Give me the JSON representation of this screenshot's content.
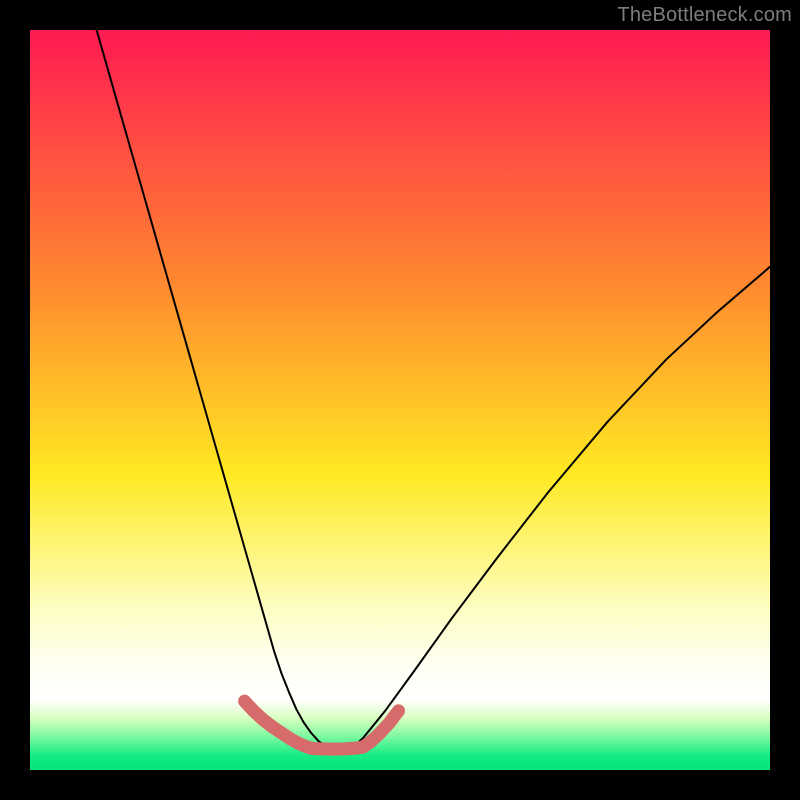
{
  "watermark": "TheBottleneck.com",
  "chart_data": {
    "type": "line",
    "title": "",
    "xlabel": "",
    "ylabel": "",
    "xlim": [
      0,
      100
    ],
    "ylim": [
      0,
      100
    ],
    "grid": false,
    "legend": false,
    "background_gradient": {
      "stops": [
        {
          "offset": 0.0,
          "color": "#ff1a52"
        },
        {
          "offset": 0.35,
          "color": "#ff8b2f"
        },
        {
          "offset": 0.6,
          "color": "#ffe922"
        },
        {
          "offset": 0.78,
          "color": "#fdfec0"
        },
        {
          "offset": 0.86,
          "color": "#fffff4"
        },
        {
          "offset": 0.905,
          "color": "#ffffff"
        },
        {
          "offset": 0.93,
          "color": "#d8ffbf"
        },
        {
          "offset": 0.955,
          "color": "#7cf9a0"
        },
        {
          "offset": 0.98,
          "color": "#17ec86"
        },
        {
          "offset": 1.0,
          "color": "#02e37b"
        }
      ]
    },
    "series": [
      {
        "name": "bottleneck-curve",
        "color": "#000000",
        "stroke_width": 2,
        "x": [
          9,
          11,
          13,
          15,
          17,
          19,
          21,
          23,
          25,
          27,
          29,
          30,
          31,
          32,
          33,
          34,
          35,
          36,
          37,
          38,
          39,
          40,
          41,
          42,
          43,
          44,
          45,
          48,
          52,
          57,
          63,
          70,
          78,
          86,
          93,
          100
        ],
        "y": [
          100,
          93,
          86,
          79,
          72,
          65,
          58,
          51,
          44,
          37,
          30,
          26.5,
          23,
          19.5,
          16,
          13,
          10.5,
          8.2,
          6.4,
          5.0,
          3.9,
          3.2,
          2.9,
          2.8,
          2.9,
          3.4,
          4.3,
          8.0,
          13.5,
          20.5,
          28.5,
          37.5,
          47.0,
          55.5,
          62.0,
          68.0
        ]
      },
      {
        "name": "highlight-segments",
        "color": "#d76b6b",
        "stroke_width": 13,
        "segments": [
          {
            "x": [
              29.0,
              30.2,
              31.5,
              32.8,
              34.0,
              35.2,
              36.3,
              37.2,
              37.8,
              38.2
            ],
            "y": [
              9.3,
              8.0,
              6.8,
              5.8,
              5.0,
              4.2,
              3.6,
              3.2,
              3.0,
              2.9
            ]
          },
          {
            "x": [
              38.2,
              39.5,
              41.0,
              42.5,
              44.0,
              45.0
            ],
            "y": [
              2.9,
              2.85,
              2.82,
              2.85,
              2.95,
              3.1
            ]
          },
          {
            "x": [
              45.0,
              46.0,
              47.2,
              48.5,
              49.8
            ],
            "y": [
              3.1,
              3.8,
              4.9,
              6.3,
              8.0
            ]
          }
        ]
      }
    ]
  }
}
